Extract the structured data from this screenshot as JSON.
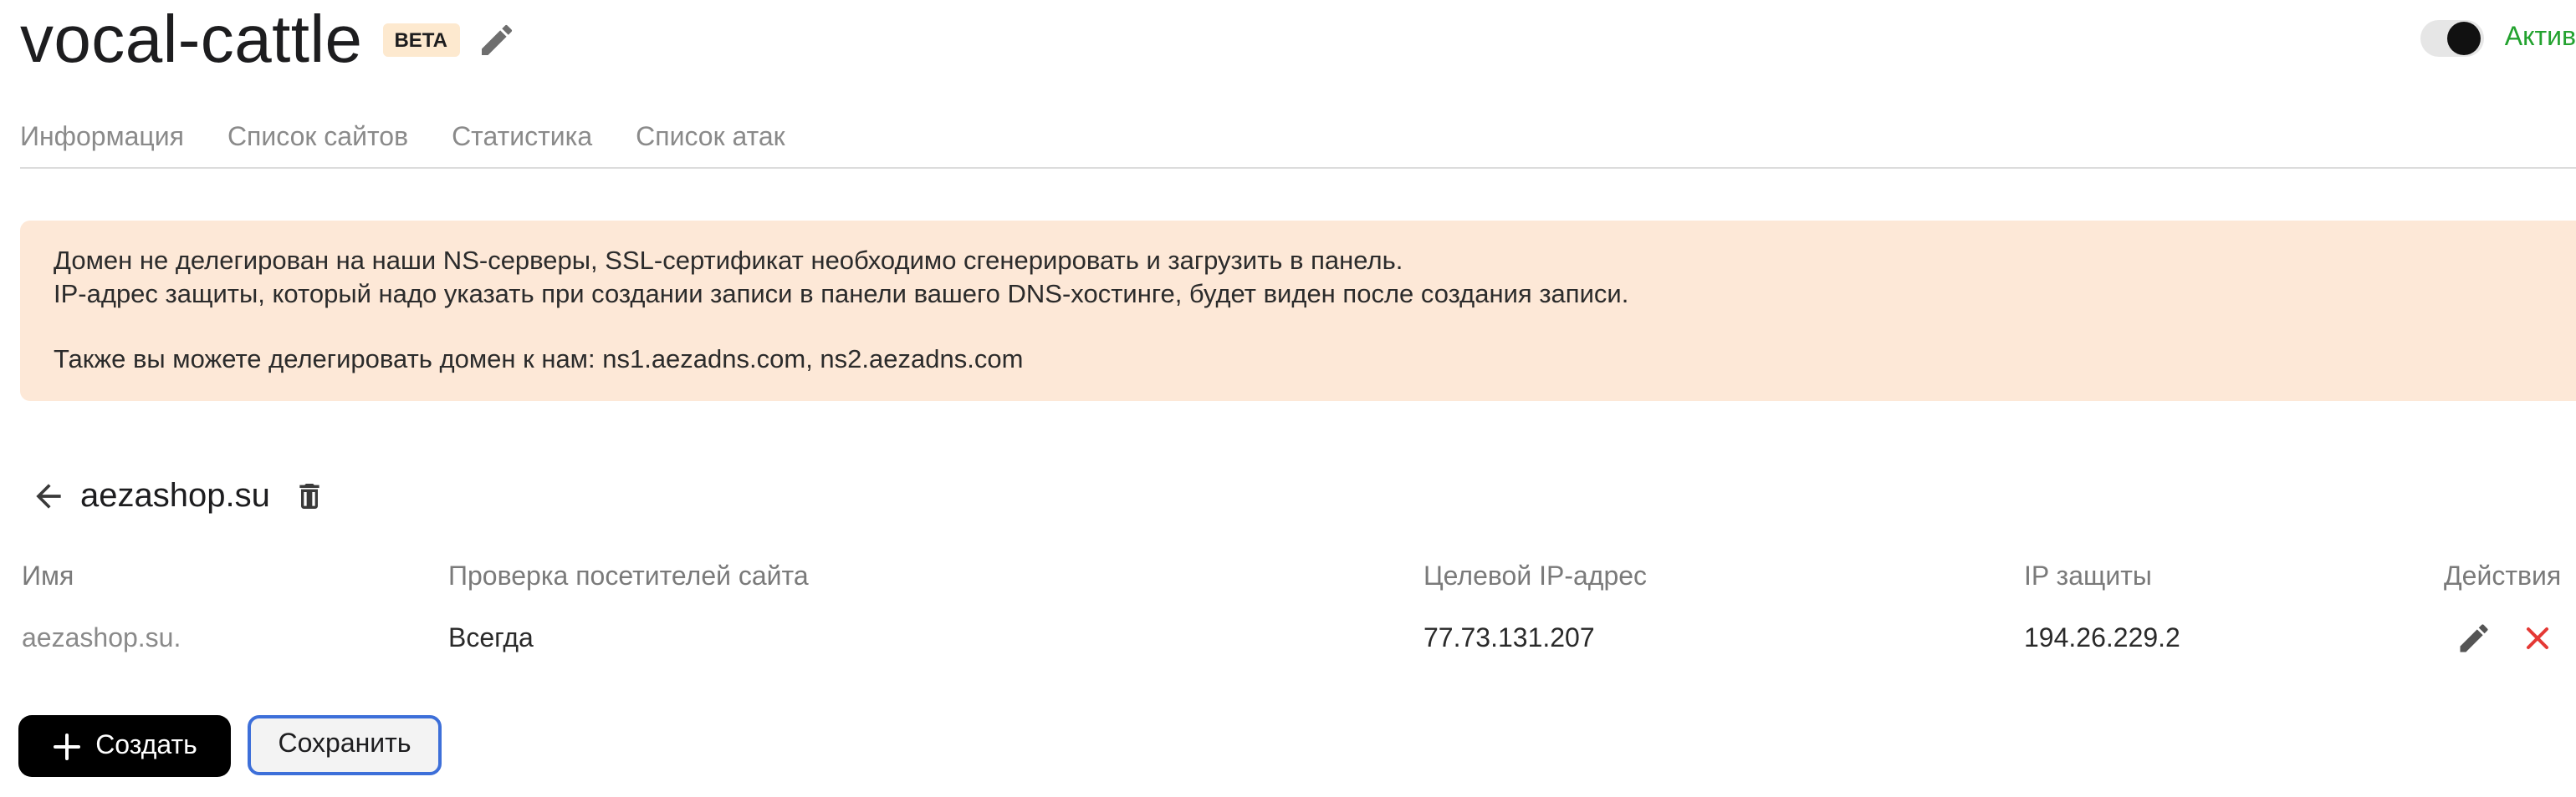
{
  "header": {
    "title": "vocal-cattle",
    "badge": "BETA",
    "status_label": "Актив"
  },
  "tabs": [
    {
      "label": "Информация"
    },
    {
      "label": "Список сайтов"
    },
    {
      "label": "Статистика"
    },
    {
      "label": "Список атак"
    }
  ],
  "alert": {
    "line1": "Домен не делегирован на наши NS-серверы, SSL-сертификат необходимо сгенерировать и загрузить в панель.",
    "line2": "IP-адрес защиты, который надо указать при создании записи в панели вашего DNS-хостинге, будет виден после создания записи.",
    "line3": "Также вы можете делегировать домен к нам: ns1.aezadns.com, ns2.aezadns.com"
  },
  "site": {
    "name": "aezashop.su"
  },
  "table": {
    "headers": [
      "Имя",
      "Проверка посетителей сайта",
      "Целевой IP-адрес",
      "IP защиты",
      "Действия"
    ],
    "rows": [
      [
        "aezashop.su.",
        "Всегда",
        "77.73.131.207",
        "194.26.229.2"
      ]
    ]
  },
  "buttons": {
    "create_label": "Создать",
    "save_label": "Сохранить"
  },
  "colors": {
    "accent_green": "#23a22f",
    "alert_bg": "#fde8d7",
    "delete_red": "#e53935",
    "focus_blue": "#3d6fd9"
  },
  "icons": {
    "edit": "pencil-icon",
    "back": "arrow-left-icon",
    "trash": "trash-icon",
    "row_edit": "pencil-icon",
    "row_delete": "close-icon",
    "create": "plus-icon"
  }
}
